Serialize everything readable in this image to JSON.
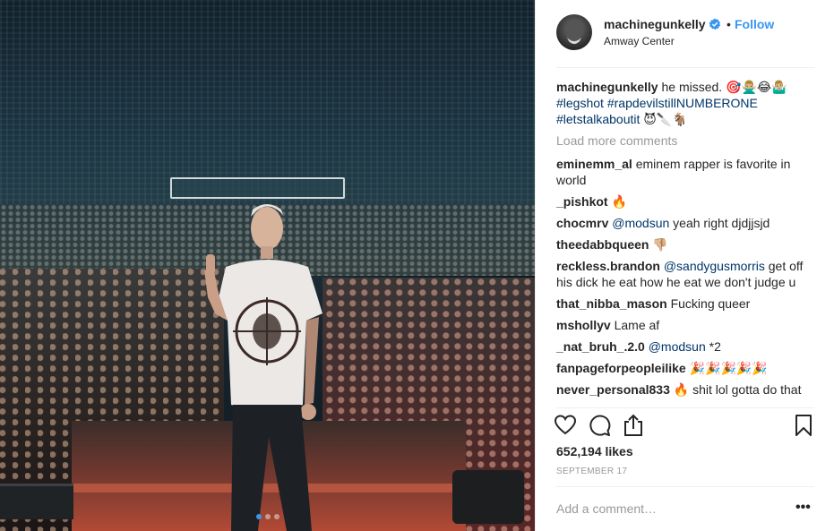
{
  "post": {
    "username": "machinegunkelly",
    "follow_label": "Follow",
    "bullet": "•",
    "location": "Amway Center"
  },
  "caption": {
    "username": "machinegunkelly",
    "text": " he missed. 🎯🙅🏼‍♂️😂🤷🏼‍♂️",
    "hashtags": [
      "#legshot",
      "#rapdevilstillNUMBERONE",
      "#letstalkaboutit"
    ],
    "trailing_emoji": " 😈🔪🐐"
  },
  "load_more": "Load more comments",
  "comments": [
    {
      "user": "eminemm_al",
      "text": " eminem rapper is favorite in world"
    },
    {
      "user": "_pishkot",
      "text": " 🔥"
    },
    {
      "user": "chocmrv",
      "mention": "@modsun",
      "text": " yeah right djdjjsjd"
    },
    {
      "user": "theedabbqueen",
      "text": " 👎🏼"
    },
    {
      "user": "reckless.brandon",
      "mention": "@sandygusmorris",
      "text": " get off his dick he eat how he eat we don't judge u"
    },
    {
      "user": "that_nibba_mason",
      "text": " Fucking queer"
    },
    {
      "user": "mshollyv",
      "text": " Lame af"
    },
    {
      "user": "_nat_bruh_.2.0",
      "mention": "@modsun",
      "text": " *2"
    },
    {
      "user": "fanpageforpeopleilike",
      "text": " 🎉🎉🎉🎉🎉"
    },
    {
      "user": "never_personal833",
      "text": " 🔥 shit lol gotta do that"
    }
  ],
  "icons": {
    "like": "heart-icon",
    "comment": "comment-icon",
    "share": "share-icon",
    "save": "bookmark-icon",
    "verified": "verified-badge-icon",
    "more": "more-options-icon"
  },
  "likes": "652,194 likes",
  "date": "SEPTEMBER 17",
  "add_comment_placeholder": "Add a comment…",
  "more_label": "•••",
  "carousel": {
    "count": 3,
    "active": 1
  },
  "colors": {
    "accent": "#3897f0",
    "link": "#003569",
    "muted": "#999999"
  }
}
